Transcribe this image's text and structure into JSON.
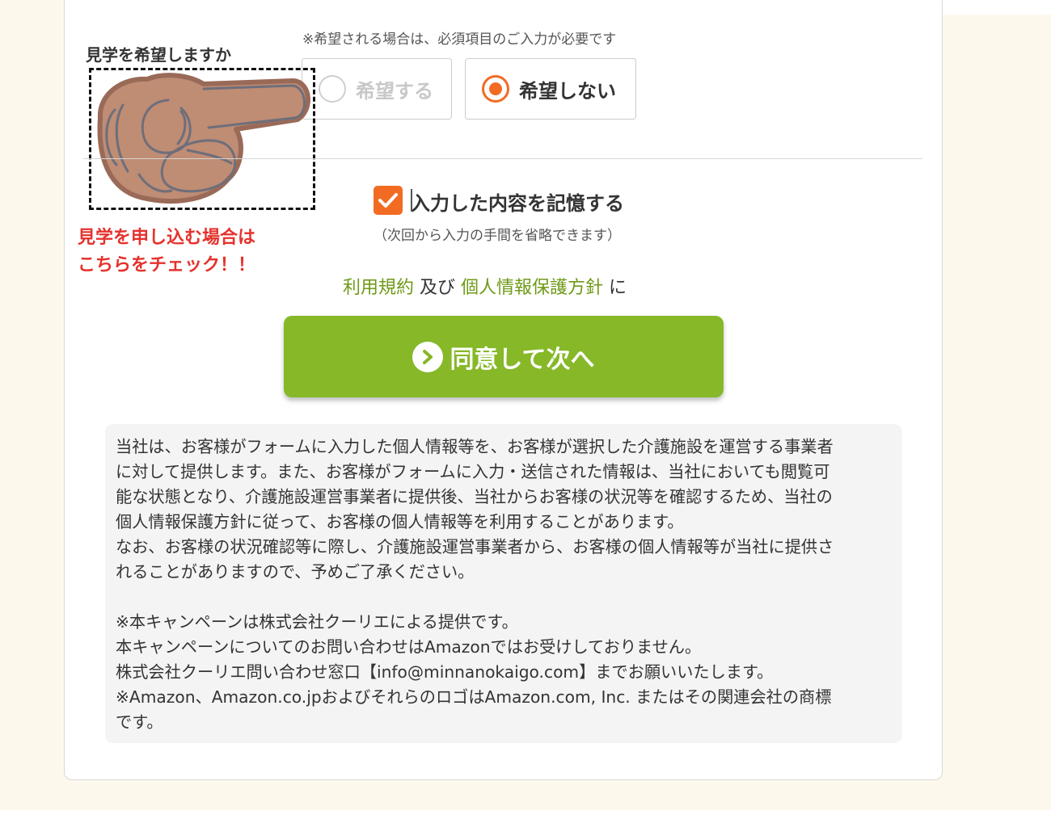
{
  "visit": {
    "label": "見学を希望しますか",
    "note": "※希望される場合は、必須項目のご入力が必要です",
    "options": [
      {
        "label": "希望する",
        "selected": false
      },
      {
        "label": "希望しない",
        "selected": true
      }
    ]
  },
  "callout": {
    "line1": "見学を申し込む場合は",
    "line2": "こちらをチェック！！"
  },
  "remember": {
    "label": "入力した内容を記憶する",
    "sub": "（次回から入力の手間を省略できます）",
    "checked": true
  },
  "terms": {
    "link1": "利用規約",
    "and": "及び",
    "link2": "個人情報保護方針",
    "suffix": "に"
  },
  "agree_button": {
    "label": "同意して次へ"
  },
  "notice": {
    "lines": [
      "当社は、お客様がフォームに入力した個人情報等を、お客様が選択した介護施設を運営する事業者",
      "に対して提供します。また、お客様がフォームに入力・送信された情報は、当社においても閲覧可",
      "能な状態となり、介護施設運営事業者に提供後、当社からお客様の状況等を確認するため、当社の",
      "個人情報保護方針に従って、お客様の個人情報等を利用することがあります。",
      "なお、お客様の状況確認等に際し、介護施設運営事業者から、お客様の個人情報等が当社に提供さ",
      "れることがありますので、予めご了承ください。",
      "",
      "※本キャンペーンは株式会社クーリエによる提供です。",
      "本キャンペーンについてのお問い合わせはAmazonではお受けしておりません。",
      "株式会社クーリエ問い合わせ窓口【info@minnanokaigo.com】までお願いいたします。",
      "※Amazon、Amazon.co.jpおよびそれらのロゴはAmazon.com, Inc. またはその関連会社の商標",
      "です。"
    ]
  },
  "colors": {
    "accent": "#f26b22",
    "button": "#86b828",
    "link": "#6f9a17",
    "callout": "#e5322d",
    "background": "#fdf8ec"
  }
}
